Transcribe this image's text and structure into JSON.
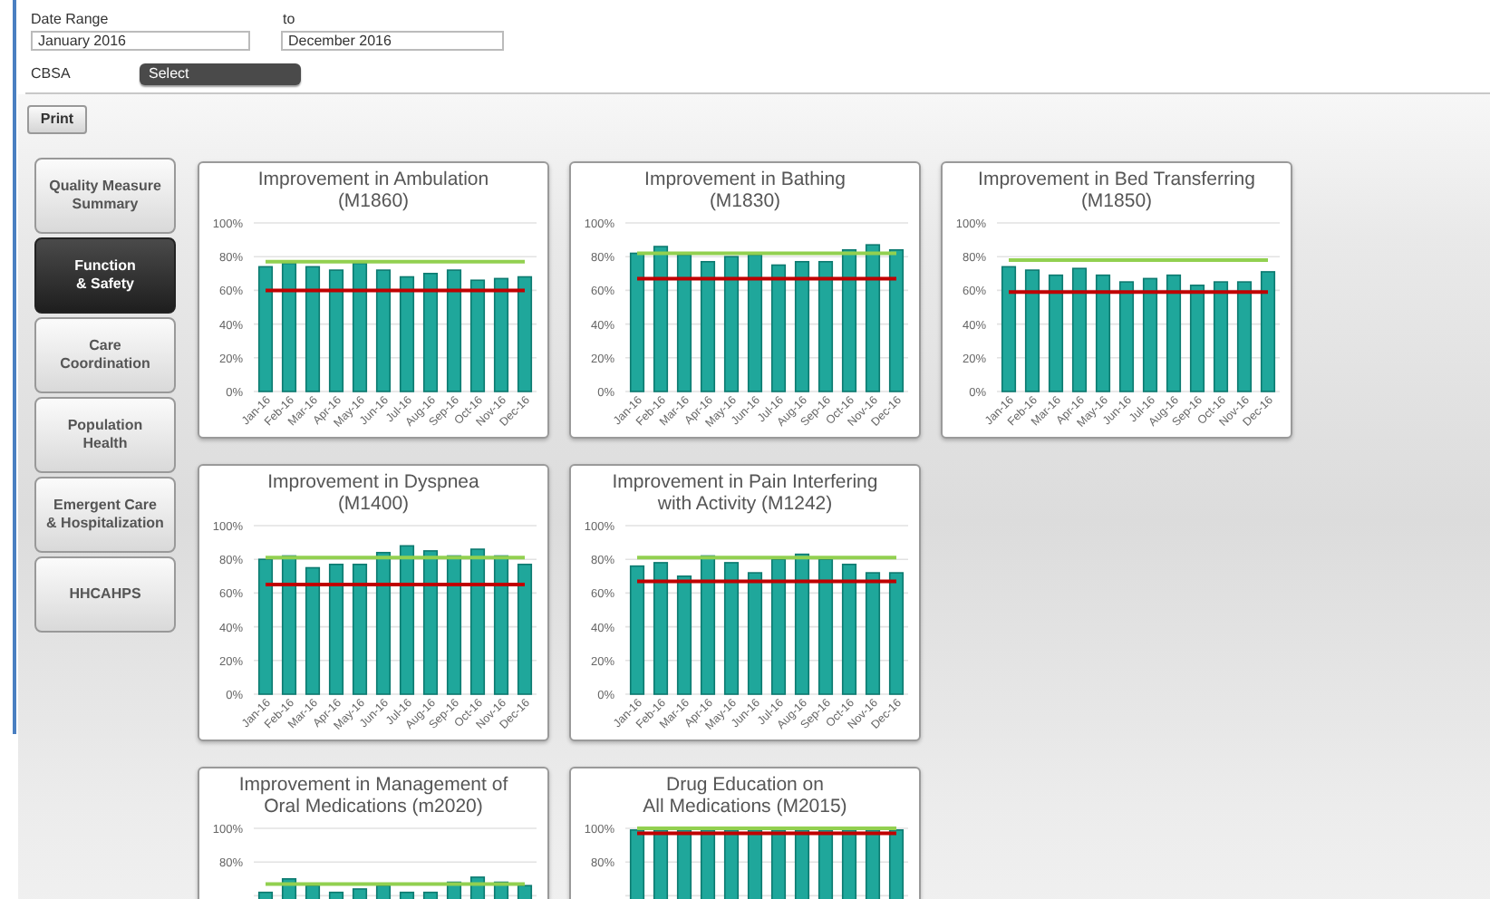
{
  "filters": {
    "date_range_label": "Date Range",
    "to_label": "to",
    "from_value": "January 2016",
    "to_value": "December 2016",
    "cbsa_label": "CBSA",
    "cbsa_value": "Select"
  },
  "print_button": "Print",
  "nav": [
    {
      "label": "Quality Measure\nSummary",
      "selected": false
    },
    {
      "label": "Function\n& Safety",
      "selected": true
    },
    {
      "label": "Care\nCoordination",
      "selected": false
    },
    {
      "label": "Population\nHealth",
      "selected": false
    },
    {
      "label": "Emergent Care\n& Hospitalization",
      "selected": false
    },
    {
      "label": "HHCAHPS",
      "selected": false
    }
  ],
  "charts": [
    {
      "chart_data": {
        "type": "bar",
        "grid": true,
        "title": "Improvement in Ambulation\n(M1860)",
        "categories": [
          "Jan-16",
          "Feb-16",
          "Mar-16",
          "Apr-16",
          "May-16",
          "Jun-16",
          "Jul-16",
          "Aug-16",
          "Sep-16",
          "Oct-16",
          "Nov-16",
          "Dec-16"
        ],
        "ylim": [
          0,
          100
        ],
        "yticks": [
          {
            "value": 0,
            "label": "0%"
          },
          {
            "value": 20,
            "label": "20%"
          },
          {
            "value": 40,
            "label": "40%"
          },
          {
            "value": 60,
            "label": "60%"
          },
          {
            "value": 80,
            "label": "80%"
          },
          {
            "value": 100,
            "label": "100%"
          }
        ],
        "series": [
          {
            "type": "bar",
            "color": "#1fa79b",
            "values": [
              74,
              76,
              74,
              72,
              76,
              72,
              68,
              70,
              72,
              66,
              67,
              68
            ]
          },
          {
            "type": "line",
            "color": "#92d050",
            "values": [
              77,
              77,
              77,
              77,
              77,
              77,
              77,
              77,
              77,
              77,
              77,
              77
            ]
          },
          {
            "type": "line",
            "color": "#c00000",
            "values": [
              60,
              60,
              60,
              60,
              60,
              60,
              60,
              60,
              60,
              60,
              60,
              60
            ]
          }
        ]
      }
    },
    {
      "chart_data": {
        "type": "bar",
        "grid": true,
        "title": "Improvement in Bathing\n(M1830)",
        "categories": [
          "Jan-16",
          "Feb-16",
          "Mar-16",
          "Apr-16",
          "May-16",
          "Jun-16",
          "Jul-16",
          "Aug-16",
          "Sep-16",
          "Oct-16",
          "Nov-16",
          "Dec-16"
        ],
        "ylim": [
          0,
          100
        ],
        "yticks": [
          {
            "value": 0,
            "label": "0%"
          },
          {
            "value": 20,
            "label": "20%"
          },
          {
            "value": 40,
            "label": "40%"
          },
          {
            "value": 60,
            "label": "60%"
          },
          {
            "value": 80,
            "label": "80%"
          },
          {
            "value": 100,
            "label": "100%"
          }
        ],
        "series": [
          {
            "type": "bar",
            "color": "#1fa79b",
            "values": [
              82,
              86,
              81,
              77,
              80,
              81,
              75,
              77,
              77,
              84,
              87,
              84
            ]
          },
          {
            "type": "line",
            "color": "#92d050",
            "values": [
              82,
              82,
              82,
              82,
              82,
              82,
              82,
              82,
              82,
              82,
              82,
              82
            ]
          },
          {
            "type": "line",
            "color": "#c00000",
            "values": [
              67,
              67,
              67,
              67,
              67,
              67,
              67,
              67,
              67,
              67,
              67,
              67
            ]
          }
        ]
      }
    },
    {
      "chart_data": {
        "type": "bar",
        "grid": true,
        "title": "Improvement in Bed Transferring\n(M1850)",
        "categories": [
          "Jan-16",
          "Feb-16",
          "Mar-16",
          "Apr-16",
          "May-16",
          "Jun-16",
          "Jul-16",
          "Aug-16",
          "Sep-16",
          "Oct-16",
          "Nov-16",
          "Dec-16"
        ],
        "ylim": [
          0,
          100
        ],
        "yticks": [
          {
            "value": 0,
            "label": "0%"
          },
          {
            "value": 20,
            "label": "20%"
          },
          {
            "value": 40,
            "label": "40%"
          },
          {
            "value": 60,
            "label": "60%"
          },
          {
            "value": 80,
            "label": "80%"
          },
          {
            "value": 100,
            "label": "100%"
          }
        ],
        "series": [
          {
            "type": "bar",
            "color": "#1fa79b",
            "values": [
              74,
              72,
              69,
              73,
              69,
              65,
              67,
              69,
              63,
              65,
              65,
              71
            ]
          },
          {
            "type": "line",
            "color": "#92d050",
            "values": [
              78,
              78,
              78,
              78,
              78,
              78,
              78,
              78,
              78,
              78,
              78,
              78
            ]
          },
          {
            "type": "line",
            "color": "#c00000",
            "values": [
              59,
              59,
              59,
              59,
              59,
              59,
              59,
              59,
              59,
              59,
              59,
              59
            ]
          }
        ]
      }
    },
    {
      "chart_data": {
        "type": "bar",
        "grid": true,
        "title": "Improvement in Dyspnea\n(M1400)",
        "categories": [
          "Jan-16",
          "Feb-16",
          "Mar-16",
          "Apr-16",
          "May-16",
          "Jun-16",
          "Jul-16",
          "Aug-16",
          "Sep-16",
          "Oct-16",
          "Nov-16",
          "Dec-16"
        ],
        "ylim": [
          0,
          100
        ],
        "yticks": [
          {
            "value": 0,
            "label": "0%"
          },
          {
            "value": 20,
            "label": "20%"
          },
          {
            "value": 40,
            "label": "40%"
          },
          {
            "value": 60,
            "label": "60%"
          },
          {
            "value": 80,
            "label": "80%"
          },
          {
            "value": 100,
            "label": "100%"
          }
        ],
        "series": [
          {
            "type": "bar",
            "color": "#1fa79b",
            "values": [
              80,
              82,
              75,
              77,
              77,
              84,
              88,
              85,
              82,
              86,
              82,
              77
            ]
          },
          {
            "type": "line",
            "color": "#92d050",
            "values": [
              81,
              81,
              81,
              81,
              81,
              81,
              81,
              81,
              81,
              81,
              81,
              81
            ]
          },
          {
            "type": "line",
            "color": "#c00000",
            "values": [
              65,
              65,
              65,
              65,
              65,
              65,
              65,
              65,
              65,
              65,
              65,
              65
            ]
          }
        ]
      }
    },
    {
      "chart_data": {
        "type": "bar",
        "grid": true,
        "title": "Improvement in Pain Interfering\nwith Activity (M1242)",
        "categories": [
          "Jan-16",
          "Feb-16",
          "Mar-16",
          "Apr-16",
          "May-16",
          "Jun-16",
          "Jul-16",
          "Aug-16",
          "Sep-16",
          "Oct-16",
          "Nov-16",
          "Dec-16"
        ],
        "ylim": [
          0,
          100
        ],
        "yticks": [
          {
            "value": 0,
            "label": "0%"
          },
          {
            "value": 20,
            "label": "20%"
          },
          {
            "value": 40,
            "label": "40%"
          },
          {
            "value": 60,
            "label": "60%"
          },
          {
            "value": 80,
            "label": "80%"
          },
          {
            "value": 100,
            "label": "100%"
          }
        ],
        "series": [
          {
            "type": "bar",
            "color": "#1fa79b",
            "values": [
              76,
              78,
              70,
              82,
              78,
              72,
              80,
              83,
              80,
              77,
              72,
              72
            ]
          },
          {
            "type": "line",
            "color": "#92d050",
            "values": [
              81,
              81,
              81,
              81,
              81,
              81,
              81,
              81,
              81,
              81,
              81,
              81
            ]
          },
          {
            "type": "line",
            "color": "#c00000",
            "values": [
              67,
              67,
              67,
              67,
              67,
              67,
              67,
              67,
              67,
              67,
              67,
              67
            ]
          }
        ]
      }
    },
    {
      "chart_data": {
        "type": "bar",
        "grid": true,
        "title": "Improvement in Management of\nOral Medications (m2020)",
        "ylim": [
          0,
          100
        ],
        "yticks": [
          {
            "value": 80,
            "label": "80%"
          },
          {
            "value": 100,
            "label": "100%"
          }
        ],
        "series": [
          {
            "type": "bar",
            "color": "#1fa79b",
            "values": [
              62,
              70,
              66,
              62,
              64,
              66,
              62,
              62,
              68,
              71,
              68,
              66
            ]
          },
          {
            "type": "line",
            "color": "#92d050",
            "values": [
              67,
              67,
              67,
              67,
              67,
              67,
              67,
              67,
              67,
              67,
              67,
              67
            ]
          }
        ]
      }
    },
    {
      "chart_data": {
        "type": "bar",
        "grid": true,
        "title": "Drug Education on\nAll Medications (M2015)",
        "ylim": [
          0,
          100
        ],
        "yticks": [
          {
            "value": 80,
            "label": "80%"
          },
          {
            "value": 100,
            "label": "100%"
          }
        ],
        "series": [
          {
            "type": "bar",
            "color": "#1fa79b",
            "values": [
              99,
              99,
              99,
              99,
              99,
              99,
              99,
              99,
              99,
              99,
              99,
              99
            ]
          },
          {
            "type": "line",
            "color": "#92d050",
            "values": [
              100,
              100,
              100,
              100,
              100,
              100,
              100,
              100,
              100,
              100,
              100,
              100
            ]
          },
          {
            "type": "line",
            "color": "#c00000",
            "values": [
              97,
              97,
              97,
              97,
              97,
              97,
              97,
              97,
              97,
              97,
              97,
              97
            ]
          }
        ]
      }
    }
  ]
}
